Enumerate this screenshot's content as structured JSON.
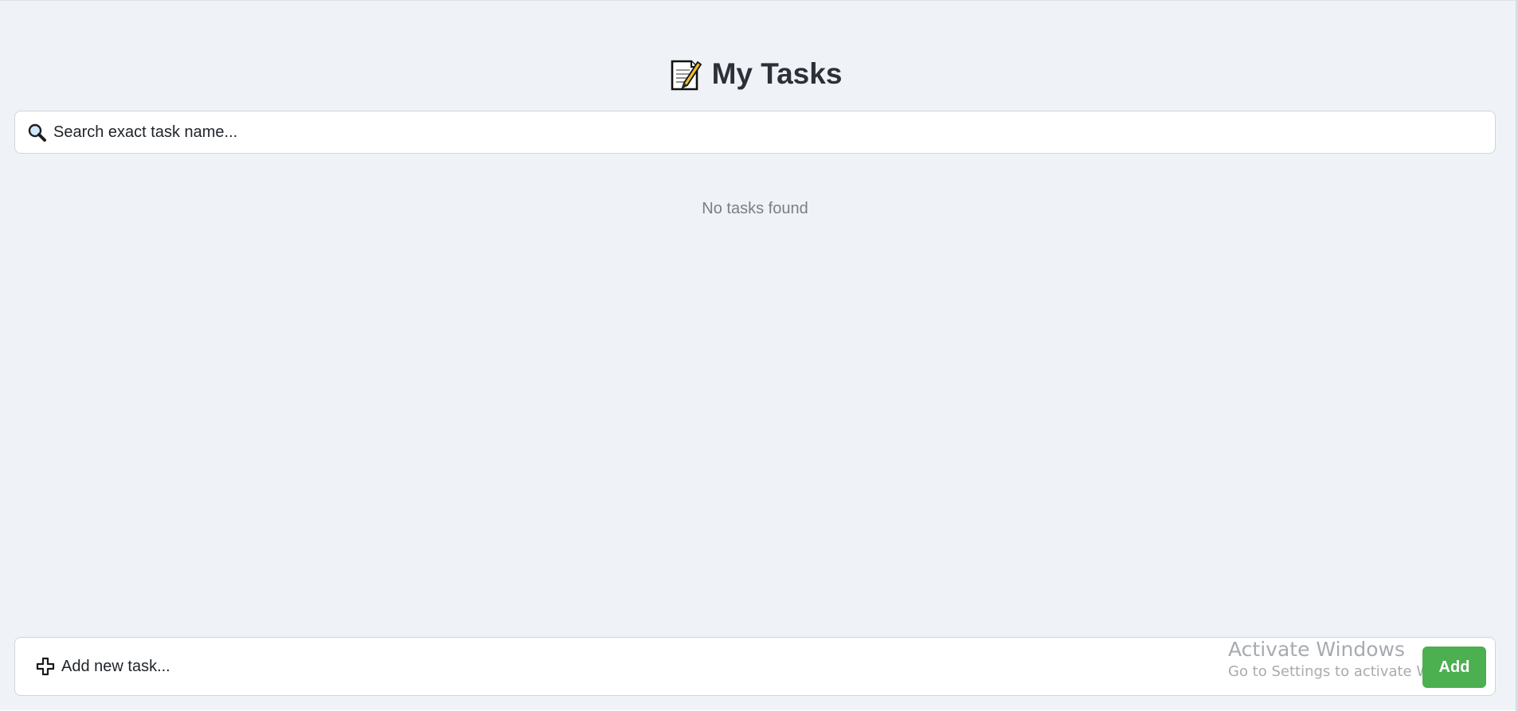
{
  "header": {
    "title": "My Tasks",
    "icon": "memo-icon"
  },
  "search": {
    "placeholder": "Search exact task name...",
    "value": "",
    "icon": "search-icon"
  },
  "tasks": {
    "empty_message": "No tasks found",
    "items": []
  },
  "new_task": {
    "placeholder": "Add new task...",
    "value": "",
    "icon": "plus-icon",
    "button_label": "Add"
  },
  "windows_overlay": {
    "title": "Activate Windows",
    "subtitle": "Go to Settings to activate Windows."
  },
  "colors": {
    "background": "#eff3f7",
    "card": "#ffffff",
    "accent": "#4caf50",
    "text": "#2c3038",
    "muted": "#7a7f86"
  }
}
